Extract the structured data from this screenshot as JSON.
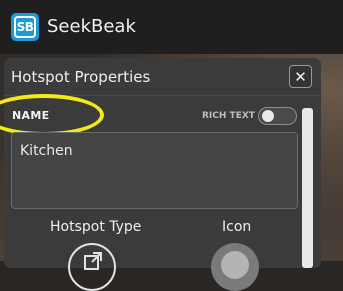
{
  "app": {
    "name": "SeekBeak",
    "logo_text": "SB"
  },
  "dialog": {
    "title": "Hotspot Properties",
    "close_symbol": "✕",
    "name_label": "NAME",
    "rich_text_label": "RICH TEXT",
    "rich_text_enabled": false,
    "name_value": "Kitchen",
    "hotspot_type_label": "Hotspot Type",
    "icon_label": "Icon"
  },
  "icons": {
    "hotspot_type": "external-link-icon",
    "hotspot_icon": "round-marker-icon",
    "close": "close-icon"
  },
  "colors": {
    "brand_blue": "#1e9ad6",
    "highlight_yellow": "#f3e915",
    "panel_bg": "#3b3b3b"
  }
}
